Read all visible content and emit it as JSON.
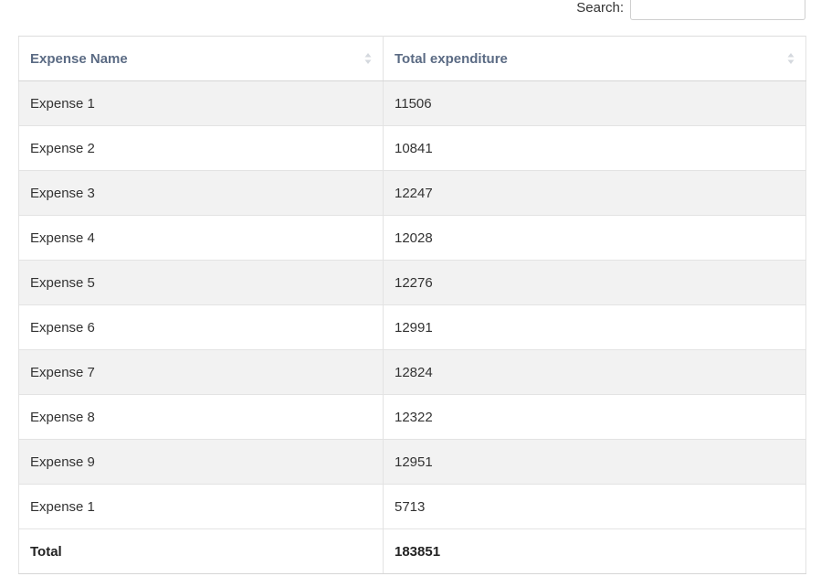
{
  "search": {
    "label": "Search:",
    "value": "",
    "placeholder": ""
  },
  "table": {
    "headers": [
      {
        "label": "Expense Name",
        "sort_icon": "sort-both-icon"
      },
      {
        "label": "Total expenditure",
        "sort_icon": "sort-both-icon"
      }
    ],
    "rows": [
      {
        "name": "Expense 1",
        "total": "11506"
      },
      {
        "name": "Expense 2",
        "total": "10841"
      },
      {
        "name": "Expense 3",
        "total": "12247"
      },
      {
        "name": "Expense 4",
        "total": "12028"
      },
      {
        "name": "Expense 5",
        "total": "12276"
      },
      {
        "name": "Expense 6",
        "total": "12991"
      },
      {
        "name": "Expense 7",
        "total": "12824"
      },
      {
        "name": "Expense 8",
        "total": "12322"
      },
      {
        "name": "Expense 9",
        "total": "12951"
      },
      {
        "name": "Expense 1",
        "total": "5713"
      }
    ],
    "footer": {
      "name": "Total",
      "total": "183851"
    }
  },
  "colors": {
    "header_text": "#5b6b84",
    "stripe": "#f2f2f2",
    "border": "#e3e3e3"
  }
}
